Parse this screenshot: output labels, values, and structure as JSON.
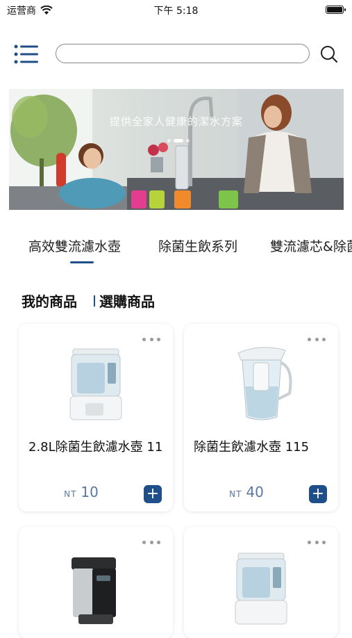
{
  "status_bar": {
    "carrier": "运营商",
    "time": "下午 5:18"
  },
  "search": {
    "value": "",
    "placeholder": ""
  },
  "banner": {
    "caption": "提供全家人健康的潔水方案"
  },
  "tabs": [
    {
      "label": "高效雙流濾水壺",
      "active": true
    },
    {
      "label": "除菌生飲系列",
      "active": false
    },
    {
      "label": "雙流濾芯&除菌",
      "active": false
    }
  ],
  "sections": {
    "my_products": "我的商品",
    "select_products": "選購商品"
  },
  "products": [
    {
      "title": "2.8L除菌生飲濾水壺 11",
      "currency": "NT",
      "price": "10",
      "icon": "water-dispenser-image"
    },
    {
      "title": "除菌生飲濾水壺 115",
      "currency": "NT",
      "price": "40",
      "icon": "water-pitcher-image"
    },
    {
      "title": "",
      "currency": "",
      "price": "",
      "icon": "hot-water-dispenser-image"
    },
    {
      "title": "",
      "currency": "",
      "price": "",
      "icon": "water-dispenser-image"
    }
  ],
  "colors": {
    "accent": "#1f4f8b",
    "price": "#5a78a3"
  }
}
